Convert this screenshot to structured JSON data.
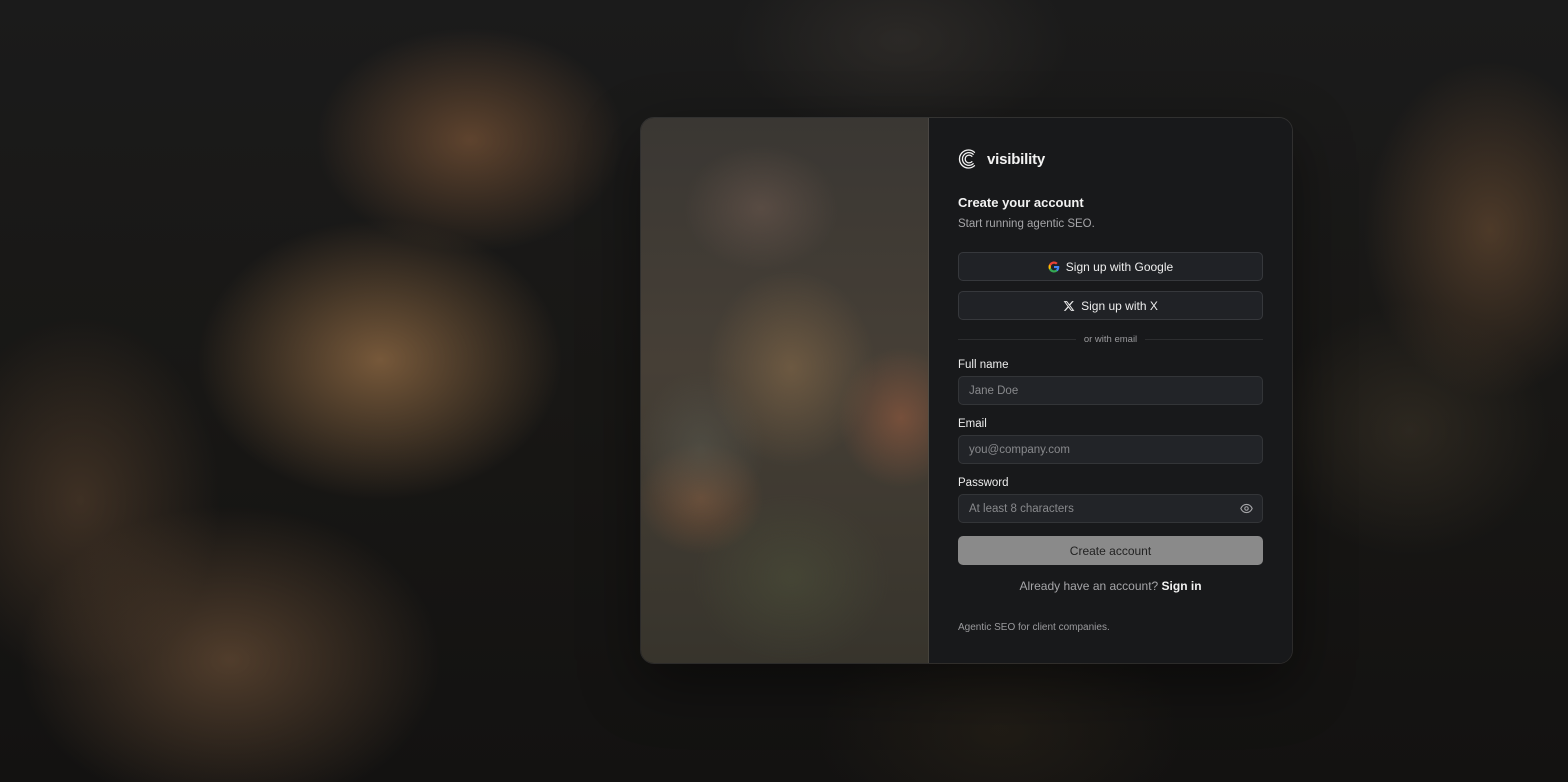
{
  "brand": {
    "name": "visibility",
    "logo_icon": "concentric-arcs-logo"
  },
  "signup": {
    "title": "Create your account",
    "subtitle": "Start running agentic SEO.",
    "google_button": "Sign up with Google",
    "google_icon": "google-g-icon",
    "x_button": "Sign up with X",
    "x_icon": "x-logo-icon",
    "divider": "or with email",
    "fields": {
      "full_name": {
        "label": "Full name",
        "placeholder": "Jane Doe",
        "value": ""
      },
      "email": {
        "label": "Email",
        "placeholder": "you@company.com",
        "value": ""
      },
      "password": {
        "label": "Password",
        "placeholder": "At least 8 characters",
        "value": "",
        "toggle_icon": "eye-icon"
      }
    },
    "submit_button": "Create account",
    "signin_prompt": "Already have an account?",
    "signin_link": "Sign in",
    "footer_note": "Agentic SEO for client companies."
  },
  "colors": {
    "panel_bg": "#18191b",
    "button_bg": "#202226",
    "input_bg": "#222428",
    "submit_bg": "#8a8a8a",
    "text_primary": "#f2f2f2",
    "text_muted": "#a5a5a8"
  }
}
